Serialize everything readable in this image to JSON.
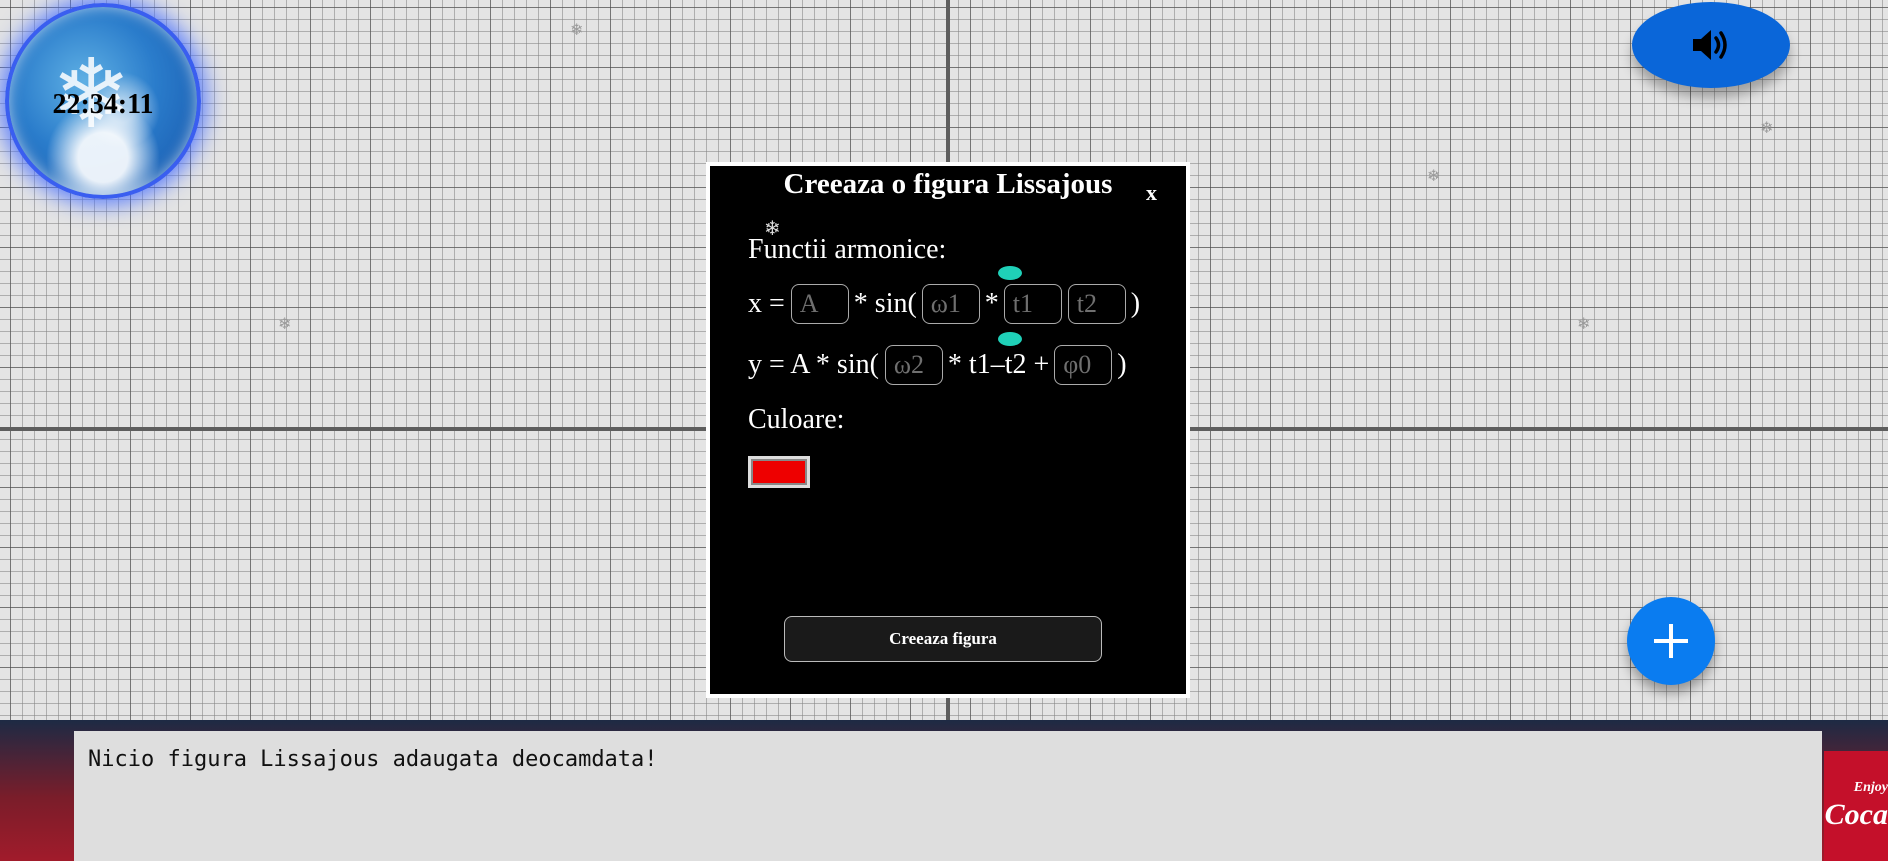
{
  "clock": {
    "time": "22:34:11"
  },
  "modal": {
    "title": "Creeaza o figura Lissajous",
    "close_label": "x",
    "harmonic_label": "Functii armonice:",
    "eq_x": {
      "prefix": "x =",
      "amp_placeholder": "A",
      "sin_open": "* sin(",
      "omega_placeholder": "ω1",
      "times": "*",
      "t1_placeholder": "t1",
      "t2_placeholder": "t2",
      "close": ")"
    },
    "eq_y": {
      "prefix": "y = A * sin(",
      "omega_placeholder": "ω2",
      "middle": "* t1–t2 +",
      "phase_placeholder": "φ0",
      "close": ")"
    },
    "color_label": "Culoare:",
    "color_value": "#ee0000",
    "create_button": "Creeaza figura"
  },
  "info_panel": {
    "message": "Nicio figura Lissajous adaugata deocamdata!"
  },
  "banner": {
    "brand_top": "Enjoy",
    "brand": "Coca"
  },
  "icons": {
    "sound": "speaker-icon",
    "add": "plus-icon"
  },
  "colors": {
    "accent": "#0a7cf0",
    "modal_bg": "#000000",
    "spin_accent": "#1fd0b8"
  }
}
